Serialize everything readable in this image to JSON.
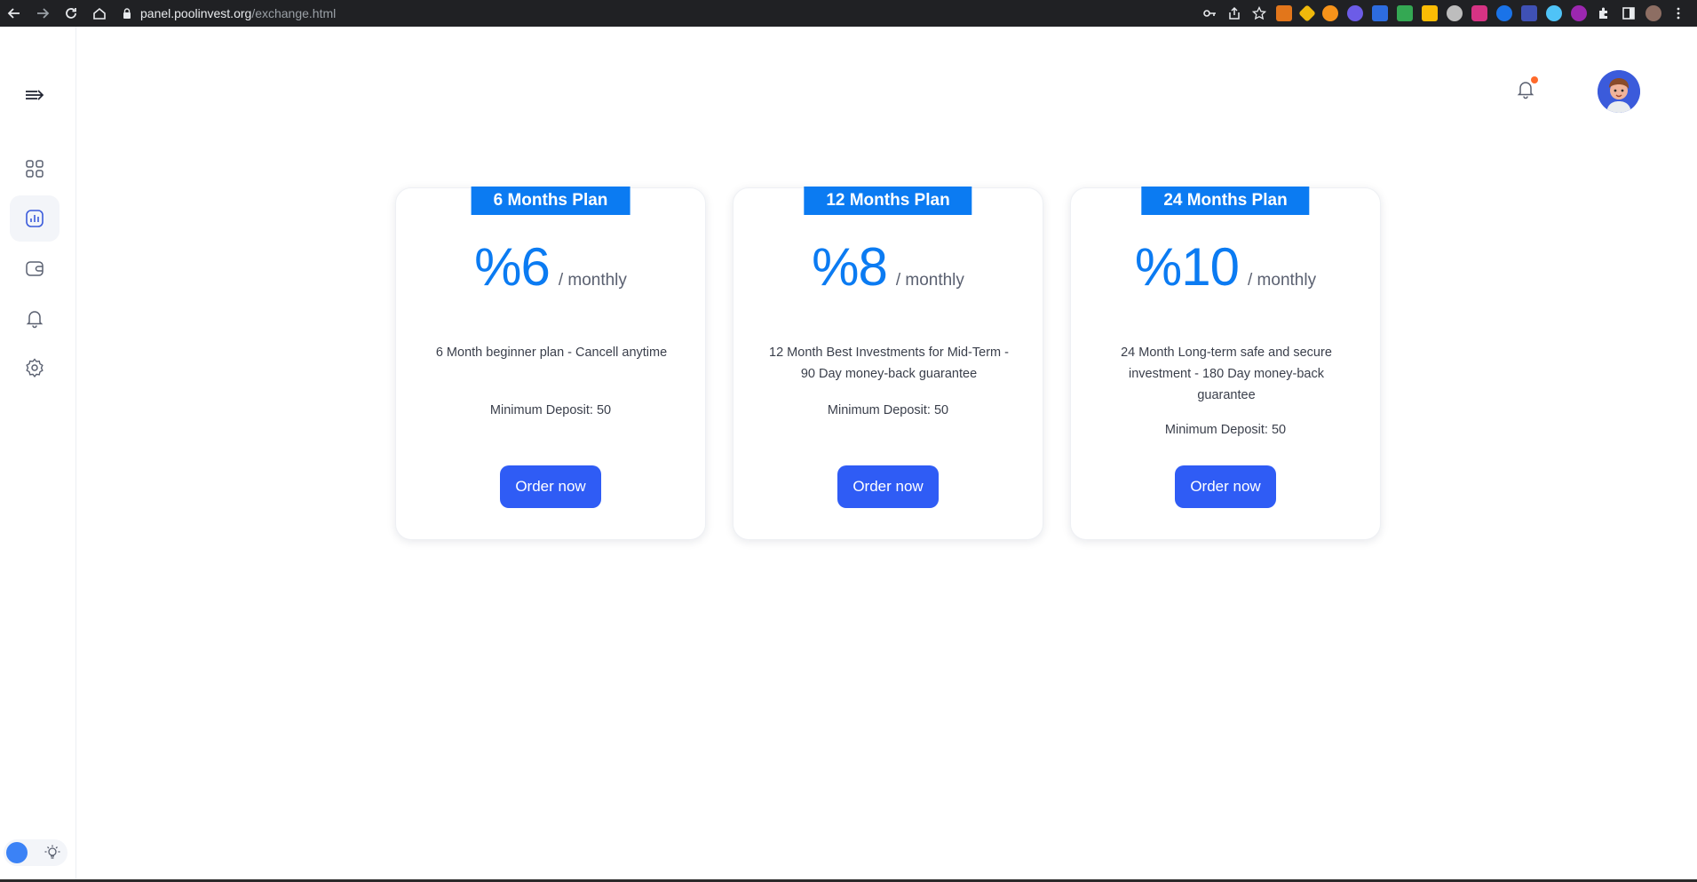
{
  "browser": {
    "url_host": "panel.poolinvest.org",
    "url_path": "/exchange.html"
  },
  "plans": [
    {
      "title": "6 Months Plan",
      "rate": "%6",
      "period": "/ monthly",
      "description": "6 Month beginner plan - Cancell anytime",
      "min_deposit": "Minimum Deposit: 50",
      "button": "Order now"
    },
    {
      "title": "12 Months Plan",
      "rate": "%8",
      "period": "/ monthly",
      "description": "12 Month Best Investments for Mid-Term - 90 Day money-back guarantee",
      "min_deposit": "Minimum Deposit: 50",
      "button": "Order now"
    },
    {
      "title": "24 Months Plan",
      "rate": "%10",
      "period": "/ monthly",
      "description": "24 Month Long-term safe and secure investment - 180 Day money-back guarantee",
      "min_deposit": "Minimum Deposit: 50",
      "button": "Order now"
    }
  ],
  "colors": {
    "accent": "#0b7bf2",
    "button": "#2f5cf5",
    "notification_dot": "#ff6a2b"
  },
  "icons": {
    "sidebar": [
      "menu-arrow-icon",
      "dashboard-grid-icon",
      "chart-icon",
      "wallet-icon",
      "bell-icon",
      "settings-gear-icon"
    ],
    "header": [
      "notification-bell-icon",
      "user-avatar"
    ]
  }
}
